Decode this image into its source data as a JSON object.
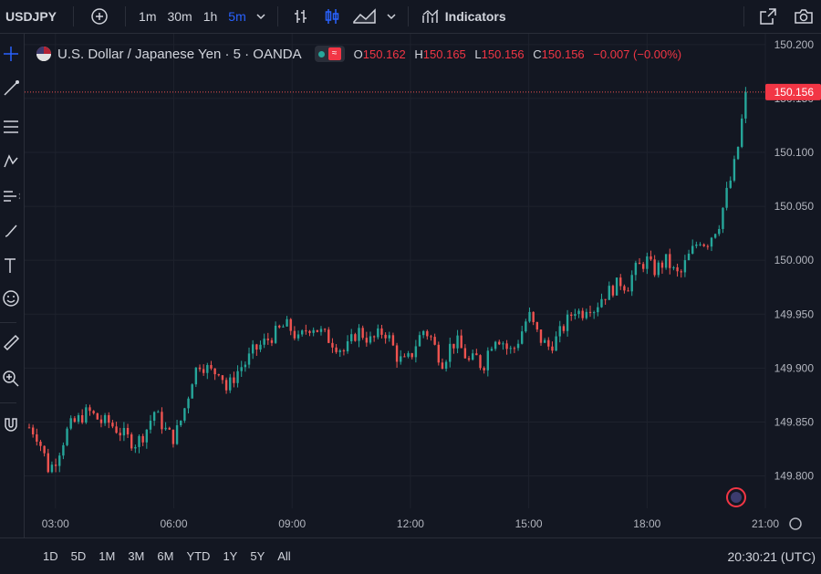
{
  "topbar": {
    "symbol": "USDJPY",
    "intervals": [
      "1m",
      "30m",
      "1h",
      "5m"
    ],
    "active_interval": "5m",
    "indicators_label": "Indicators"
  },
  "legend": {
    "title": "U.S. Dollar / Japanese Yen · 5 · OANDA",
    "o_label": "O",
    "o_val": "150.162",
    "h_label": "H",
    "h_val": "150.165",
    "l_label": "L",
    "l_val": "150.156",
    "c_label": "C",
    "c_val": "150.156",
    "change": "−0.007 (−0.00%)"
  },
  "bottombar": {
    "ranges": [
      "1D",
      "5D",
      "1M",
      "3M",
      "6M",
      "YTD",
      "1Y",
      "5Y",
      "All"
    ],
    "time": "20:30:21 (UTC)"
  },
  "colors": {
    "bg": "#131722",
    "up": "#26a69a",
    "down": "#ef5350",
    "grid": "#1e222d",
    "text": "#d1d4dc",
    "accent": "#2962ff"
  },
  "chart_data": {
    "type": "candlestick",
    "price_axis_ticks": [
      "150.200",
      "150.150",
      "150.100",
      "150.050",
      "150.000",
      "149.950",
      "149.900",
      "149.850",
      "149.800"
    ],
    "time_axis_ticks": [
      "03:00",
      "06:00",
      "09:00",
      "12:00",
      "15:00",
      "18:00",
      "21:00"
    ],
    "ylim": [
      149.77,
      150.21
    ],
    "current_price_label": "150.156",
    "series": [
      {
        "time": "02:20",
        "close": 149.845
      },
      {
        "time": "02:30",
        "close": 149.84
      },
      {
        "time": "02:40",
        "close": 149.825
      },
      {
        "time": "02:50",
        "close": 149.805
      },
      {
        "time": "03:00",
        "close": 149.815
      },
      {
        "time": "03:10",
        "close": 149.83
      },
      {
        "time": "03:20",
        "close": 149.845
      },
      {
        "time": "03:30",
        "close": 149.85
      },
      {
        "time": "03:40",
        "close": 149.855
      },
      {
        "time": "03:50",
        "close": 149.86
      },
      {
        "time": "04:00",
        "close": 149.855
      },
      {
        "time": "04:10",
        "close": 149.85
      },
      {
        "time": "04:20",
        "close": 149.85
      },
      {
        "time": "04:30",
        "close": 149.845
      },
      {
        "time": "04:40",
        "close": 149.84
      },
      {
        "time": "04:50",
        "close": 149.835
      },
      {
        "time": "05:00",
        "close": 149.83
      },
      {
        "time": "05:10",
        "close": 149.835
      },
      {
        "time": "05:20",
        "close": 149.845
      },
      {
        "time": "05:30",
        "close": 149.86
      },
      {
        "time": "05:40",
        "close": 149.85
      },
      {
        "time": "05:50",
        "close": 149.84
      },
      {
        "time": "06:00",
        "close": 149.835
      },
      {
        "time": "06:10",
        "close": 149.85
      },
      {
        "time": "06:20",
        "close": 149.87
      },
      {
        "time": "06:30",
        "close": 149.895
      },
      {
        "time": "06:40",
        "close": 149.905
      },
      {
        "time": "06:50",
        "close": 149.9
      },
      {
        "time": "07:00",
        "close": 149.895
      },
      {
        "time": "07:10",
        "close": 149.9
      },
      {
        "time": "07:20",
        "close": 149.88
      },
      {
        "time": "07:30",
        "close": 149.89
      },
      {
        "time": "07:40",
        "close": 149.9
      },
      {
        "time": "07:50",
        "close": 149.905
      },
      {
        "time": "08:00",
        "close": 149.915
      },
      {
        "time": "08:10",
        "close": 149.92
      },
      {
        "time": "08:20",
        "close": 149.925
      },
      {
        "time": "08:30",
        "close": 149.93
      },
      {
        "time": "08:40",
        "close": 149.935
      },
      {
        "time": "08:50",
        "close": 149.94
      },
      {
        "time": "09:00",
        "close": 149.935
      },
      {
        "time": "09:10",
        "close": 149.925
      },
      {
        "time": "09:20",
        "close": 149.935
      },
      {
        "time": "09:30",
        "close": 149.94
      },
      {
        "time": "09:40",
        "close": 149.935
      },
      {
        "time": "09:50",
        "close": 149.93
      },
      {
        "time": "10:00",
        "close": 149.925
      },
      {
        "time": "10:10",
        "close": 149.92
      },
      {
        "time": "10:20",
        "close": 149.915
      },
      {
        "time": "10:30",
        "close": 149.925
      },
      {
        "time": "10:40",
        "close": 149.935
      },
      {
        "time": "10:50",
        "close": 149.93
      },
      {
        "time": "11:00",
        "close": 149.925
      },
      {
        "time": "11:10",
        "close": 149.93
      },
      {
        "time": "11:20",
        "close": 149.935
      },
      {
        "time": "11:30",
        "close": 149.925
      },
      {
        "time": "11:40",
        "close": 149.91
      },
      {
        "time": "11:50",
        "close": 149.905
      },
      {
        "time": "12:00",
        "close": 149.91
      },
      {
        "time": "12:10",
        "close": 149.925
      },
      {
        "time": "12:20",
        "close": 149.935
      },
      {
        "time": "12:30",
        "close": 149.93
      },
      {
        "time": "12:40",
        "close": 149.915
      },
      {
        "time": "12:50",
        "close": 149.905
      },
      {
        "time": "13:00",
        "close": 149.92
      },
      {
        "time": "13:10",
        "close": 149.925
      },
      {
        "time": "13:20",
        "close": 149.915
      },
      {
        "time": "13:30",
        "close": 149.905
      },
      {
        "time": "13:40",
        "close": 149.91
      },
      {
        "time": "13:50",
        "close": 149.9
      },
      {
        "time": "14:00",
        "close": 149.92
      },
      {
        "time": "14:10",
        "close": 149.93
      },
      {
        "time": "14:20",
        "close": 149.925
      },
      {
        "time": "14:30",
        "close": 149.915
      },
      {
        "time": "14:40",
        "close": 149.92
      },
      {
        "time": "14:50",
        "close": 149.935
      },
      {
        "time": "15:00",
        "close": 149.95
      },
      {
        "time": "15:10",
        "close": 149.935
      },
      {
        "time": "15:20",
        "close": 149.925
      },
      {
        "time": "15:30",
        "close": 149.92
      },
      {
        "time": "15:40",
        "close": 149.925
      },
      {
        "time": "15:50",
        "close": 149.935
      },
      {
        "time": "16:00",
        "close": 149.945
      },
      {
        "time": "16:10",
        "close": 149.955
      },
      {
        "time": "16:20",
        "close": 149.95
      },
      {
        "time": "16:30",
        "close": 149.96
      },
      {
        "time": "16:40",
        "close": 149.955
      },
      {
        "time": "16:50",
        "close": 149.965
      },
      {
        "time": "17:00",
        "close": 149.97
      },
      {
        "time": "17:10",
        "close": 149.975
      },
      {
        "time": "17:20",
        "close": 149.98
      },
      {
        "time": "17:30",
        "close": 149.975
      },
      {
        "time": "17:40",
        "close": 149.99
      },
      {
        "time": "17:50",
        "close": 149.995
      },
      {
        "time": "18:00",
        "close": 150.0
      },
      {
        "time": "18:10",
        "close": 149.99
      },
      {
        "time": "18:20",
        "close": 149.995
      },
      {
        "time": "18:30",
        "close": 150.0
      },
      {
        "time": "18:40",
        "close": 149.99
      },
      {
        "time": "18:50",
        "close": 149.985
      },
      {
        "time": "19:00",
        "close": 150.0
      },
      {
        "time": "19:10",
        "close": 150.01
      },
      {
        "time": "19:20",
        "close": 150.02
      },
      {
        "time": "19:30",
        "close": 150.015
      },
      {
        "time": "19:40",
        "close": 150.025
      },
      {
        "time": "19:50",
        "close": 150.035
      },
      {
        "time": "20:00",
        "close": 150.06
      },
      {
        "time": "20:10",
        "close": 150.08
      },
      {
        "time": "20:20",
        "close": 150.11
      },
      {
        "time": "20:30",
        "close": 150.156
      }
    ]
  }
}
